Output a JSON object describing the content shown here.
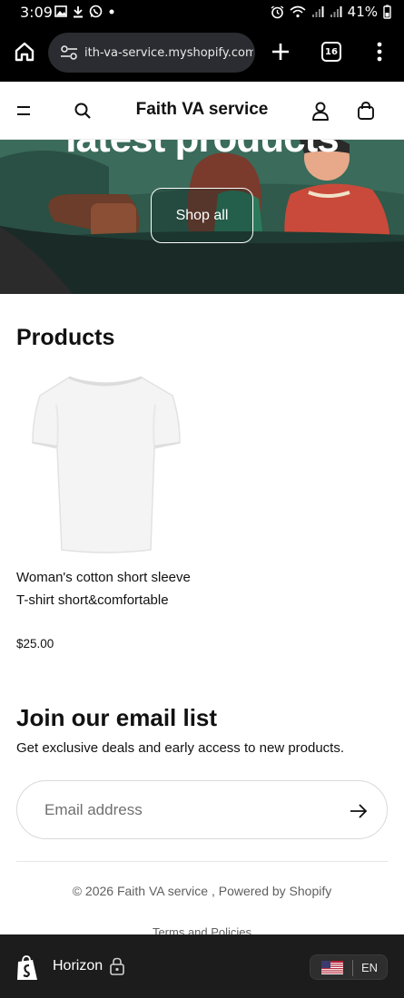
{
  "status_bar": {
    "time": "3:09",
    "battery": "41%",
    "left_icons": [
      "gallery-icon",
      "download-icon",
      "whatsapp-icon",
      "dot-icon"
    ],
    "right_icons": [
      "alarm-icon",
      "wifi-icon",
      "signal-icon",
      "signal-icon"
    ]
  },
  "browser": {
    "url": "ith-va-service.myshopify.com",
    "tab_count": "16"
  },
  "store": {
    "title": "Faith VA service"
  },
  "hero": {
    "heading": "latest products",
    "cta_label": "Shop all"
  },
  "products": {
    "title": "Products",
    "items": [
      {
        "name": "Woman's cotton short sleeve T-shirt short&comfortable",
        "price": "$25.00"
      }
    ]
  },
  "newsletter": {
    "title": "Join our email list",
    "subtitle": "Get exclusive deals and early access to new products.",
    "email_placeholder": "Email address"
  },
  "footer": {
    "copyright": "© 2026 Faith VA service , Powered by Shopify",
    "policies_link": "Terms and Policies"
  },
  "preview_bar": {
    "theme_name": "Horizon",
    "locale_code": "EN"
  },
  "colors": {
    "hero_background": "#2f5a4c",
    "browser_chrome": "#000000",
    "preview_bar": "#1c1c1c"
  }
}
